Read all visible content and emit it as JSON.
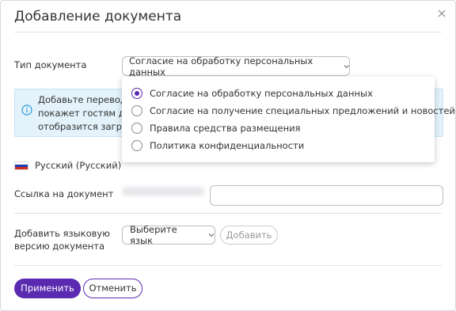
{
  "dialog": {
    "title": "Добавление документа"
  },
  "doc_type": {
    "label": "Тип документа",
    "selected": "Согласие на обработку персональных данных"
  },
  "info": {
    "lines": [
      "Добавьте переводы",
      "покажет гостям док",
      "отобразится загруж"
    ]
  },
  "dropdown": {
    "options": [
      {
        "label": "Согласие на обработку персональных данных",
        "selected": true
      },
      {
        "label": "Согласие на получение специальных предложений и новостей",
        "selected": false
      },
      {
        "label": "Правила средства размещения",
        "selected": false
      },
      {
        "label": "Политика конфиденциальности",
        "selected": false
      }
    ]
  },
  "language": {
    "name": "Русский (Русский)",
    "flag_colors": [
      "#ffffff",
      "#1c3fb5",
      "#d52b1e"
    ]
  },
  "link": {
    "label": "Ссылка на документ",
    "value": ""
  },
  "add_language": {
    "label_line1": "Добавить языковую",
    "label_line2": "версию документа",
    "select_label": "Выберите язык",
    "add_button": "Добавить"
  },
  "footer": {
    "apply": "Применить",
    "cancel": "Отменить"
  },
  "colors": {
    "accent": "#5a2ab0",
    "info_bg": "#e3f2fb",
    "info_icon": "#2a9bd6"
  }
}
